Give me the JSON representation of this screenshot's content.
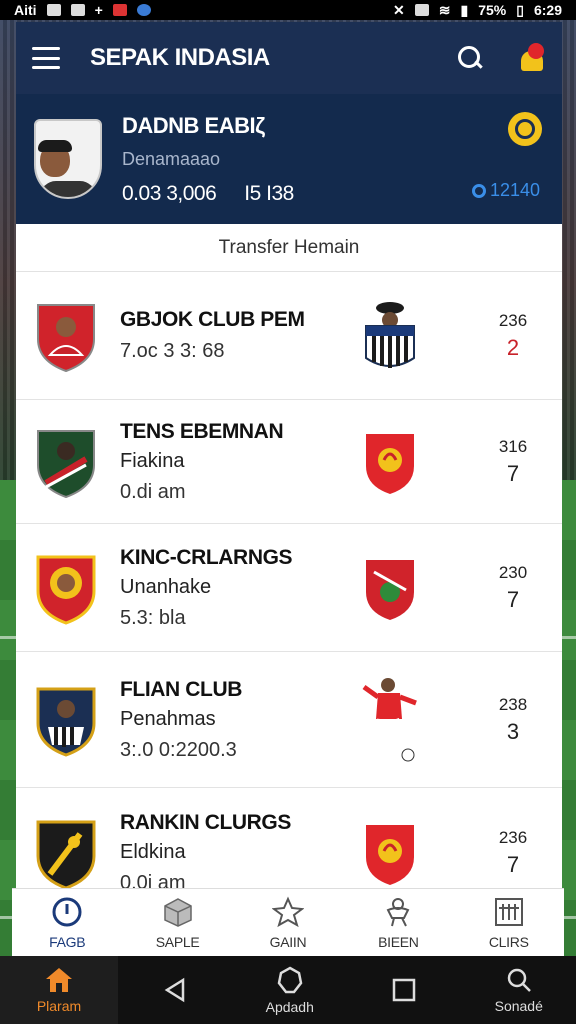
{
  "status_bar": {
    "left": "Aiti",
    "right": "75%",
    "time": "6:29"
  },
  "app_title": "SEPAK INDASIA",
  "profile": {
    "name": "DADNB EABIζ",
    "subtitle": "Denamaaao",
    "stat1": "0.03 3,006",
    "stat2": "I5 I38",
    "balance": "12140"
  },
  "section_title": "Transfer Hemain",
  "clubs": [
    {
      "name": "GBJOK CLUB PEM",
      "subtitle": "",
      "meta": "7.oc 3 3: 68",
      "score_top": "236",
      "score_bottom": "2",
      "bottom_color": "#c8222a"
    },
    {
      "name": "TENS EBEMNAN",
      "subtitle": "Fiakina",
      "meta": "0.di am",
      "score_top": "316",
      "score_bottom": "7",
      "bottom_color": "#222222"
    },
    {
      "name": "KINC-CRLARNGS",
      "subtitle": "Unanhake",
      "meta": "5.3: bla",
      "score_top": "230",
      "score_bottom": "7",
      "bottom_color": "#222222"
    },
    {
      "name": "FLIAN CLUB",
      "subtitle": "Penahmas",
      "meta": "3:.0 0:2200.3",
      "score_top": "238",
      "score_bottom": "3",
      "bottom_color": "#222222"
    },
    {
      "name": "RANKIN CLURGS",
      "subtitle": "Eldkina",
      "meta": "0.0i am",
      "score_top": "236",
      "score_bottom": "7",
      "bottom_color": "#222222"
    }
  ],
  "tabs": [
    {
      "label": "FAGB",
      "icon": "power-icon"
    },
    {
      "label": "SAPLE",
      "icon": "cube-icon"
    },
    {
      "label": "GAIIN",
      "icon": "star-icon"
    },
    {
      "label": "BIEEN",
      "icon": "player-icon"
    },
    {
      "label": "CLIRS",
      "icon": "grid-icon"
    }
  ],
  "system_nav": [
    {
      "label": "Plaram",
      "icon": "house-icon"
    },
    {
      "label": "",
      "icon": "back-icon"
    },
    {
      "label": "Apdadh",
      "icon": "circle-icon"
    },
    {
      "label": "",
      "icon": "square-icon"
    },
    {
      "label": "Sonadé",
      "icon": "search-icon"
    }
  ],
  "colors": {
    "header": "#1b2f53",
    "accent": "#3a8ee8",
    "highlight": "#f08a2a",
    "red": "#c8222a"
  }
}
